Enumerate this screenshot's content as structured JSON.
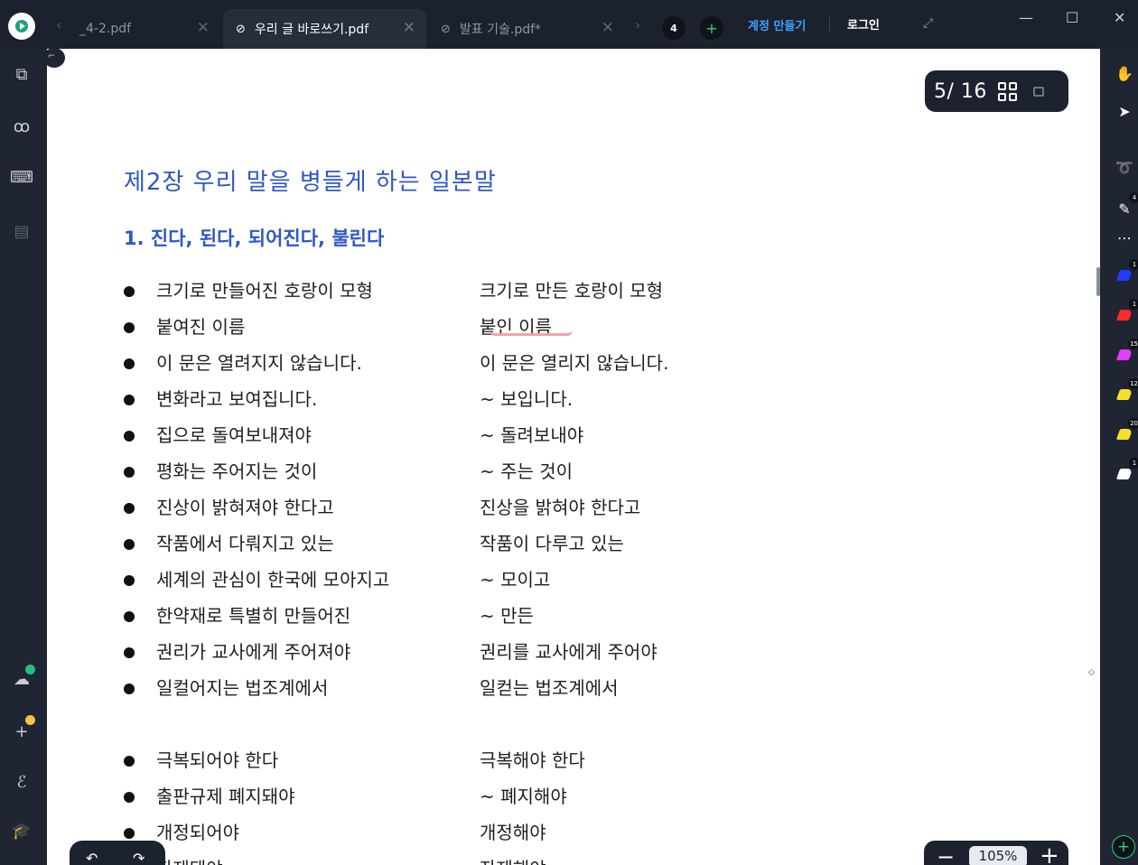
{
  "tabs": [
    {
      "label": "_4-2.pdf",
      "active": false
    },
    {
      "label": "우리 글 바로쓰기.pdf",
      "active": true
    },
    {
      "label": "발표 기술.pdf*",
      "active": false
    }
  ],
  "tab_count": "4",
  "signup_label": "계정 만들기",
  "login_label": "로그인",
  "page_indicator": "5/ 16",
  "zoom_level": "105%",
  "document": {
    "chapter_title": "제2장 우리 말을 병들게 하는 일본말",
    "section_title": "1. 진다, 된다, 되어진다, 불린다",
    "rows": [
      {
        "left": "크기로 만들어진 호랑이 모형",
        "right": "크기로 만든 호랑이 모형"
      },
      {
        "left": "붙여진 이름",
        "right": "붙인 이름"
      },
      {
        "left": "이 문은 열려지지 않습니다.",
        "right": "이 문은 열리지 않습니다."
      },
      {
        "left": "변화라고 보여집니다.",
        "right": "~ 보입니다."
      },
      {
        "left": "집으로 돌여보내져야",
        "right": "~ 돌려보내야"
      },
      {
        "left": "평화는 주어지는 것이",
        "right": "~ 주는 것이"
      },
      {
        "left": "진상이 밝혀져야 한다고",
        "right": "진상을 밝혀야 한다고"
      },
      {
        "left": "작품에서 다뤄지고 있는",
        "right": "작품이 다루고 있는"
      },
      {
        "left": "세계의 관심이 한국에 모아지고",
        "right": "~ 모이고"
      },
      {
        "left": "한약재로 특별히 만들어진",
        "right": "~ 만든"
      },
      {
        "left": "권리가 교사에게 주어져야",
        "right": "권리를 교사에게 주어야"
      },
      {
        "left": "일컬어지는 법조계에서",
        "right": "일컫는 법조계에서"
      }
    ],
    "rows2": [
      {
        "left": "극복되어야 한다",
        "right": "극복해야 한다"
      },
      {
        "left": "출판규제 폐지돼야",
        "right": "~ 폐지해야"
      },
      {
        "left": "개정되어야",
        "right": "개정해야"
      },
      {
        "left": "자제돼야",
        "right": "자제해야"
      }
    ]
  },
  "tool_badges": [
    "4",
    "1",
    "1",
    "15",
    "12",
    "20",
    "1"
  ],
  "colors": {
    "heading_blue": "#2f57c7",
    "link_blue": "#3ea0ff",
    "accent_green": "#2fd27a",
    "pen_blue": "#1f3dff",
    "pen_red": "#ff2a2a",
    "pen_magenta": "#e43cff",
    "pen_yellow": "#f5e12a"
  }
}
